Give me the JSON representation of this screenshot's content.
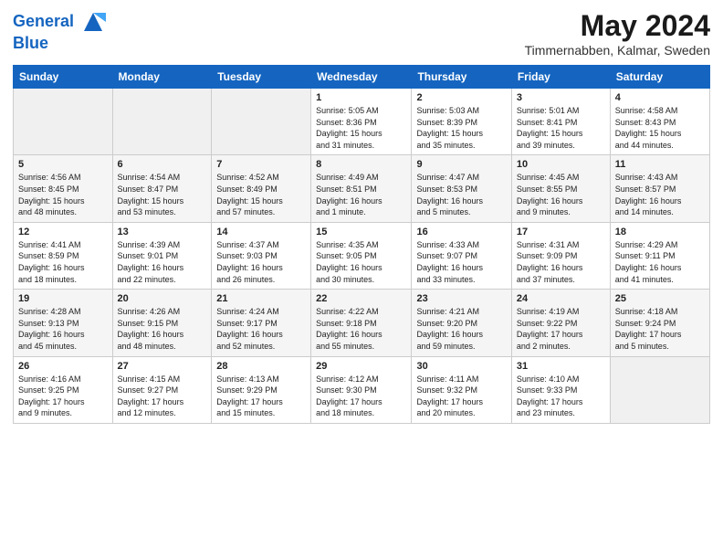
{
  "header": {
    "logo_line1": "General",
    "logo_line2": "Blue",
    "month_year": "May 2024",
    "location": "Timmernabben, Kalmar, Sweden"
  },
  "days_of_week": [
    "Sunday",
    "Monday",
    "Tuesday",
    "Wednesday",
    "Thursday",
    "Friday",
    "Saturday"
  ],
  "weeks": [
    [
      {
        "day": "",
        "info": ""
      },
      {
        "day": "",
        "info": ""
      },
      {
        "day": "",
        "info": ""
      },
      {
        "day": "1",
        "info": "Sunrise: 5:05 AM\nSunset: 8:36 PM\nDaylight: 15 hours\nand 31 minutes."
      },
      {
        "day": "2",
        "info": "Sunrise: 5:03 AM\nSunset: 8:39 PM\nDaylight: 15 hours\nand 35 minutes."
      },
      {
        "day": "3",
        "info": "Sunrise: 5:01 AM\nSunset: 8:41 PM\nDaylight: 15 hours\nand 39 minutes."
      },
      {
        "day": "4",
        "info": "Sunrise: 4:58 AM\nSunset: 8:43 PM\nDaylight: 15 hours\nand 44 minutes."
      }
    ],
    [
      {
        "day": "5",
        "info": "Sunrise: 4:56 AM\nSunset: 8:45 PM\nDaylight: 15 hours\nand 48 minutes."
      },
      {
        "day": "6",
        "info": "Sunrise: 4:54 AM\nSunset: 8:47 PM\nDaylight: 15 hours\nand 53 minutes."
      },
      {
        "day": "7",
        "info": "Sunrise: 4:52 AM\nSunset: 8:49 PM\nDaylight: 15 hours\nand 57 minutes."
      },
      {
        "day": "8",
        "info": "Sunrise: 4:49 AM\nSunset: 8:51 PM\nDaylight: 16 hours\nand 1 minute."
      },
      {
        "day": "9",
        "info": "Sunrise: 4:47 AM\nSunset: 8:53 PM\nDaylight: 16 hours\nand 5 minutes."
      },
      {
        "day": "10",
        "info": "Sunrise: 4:45 AM\nSunset: 8:55 PM\nDaylight: 16 hours\nand 9 minutes."
      },
      {
        "day": "11",
        "info": "Sunrise: 4:43 AM\nSunset: 8:57 PM\nDaylight: 16 hours\nand 14 minutes."
      }
    ],
    [
      {
        "day": "12",
        "info": "Sunrise: 4:41 AM\nSunset: 8:59 PM\nDaylight: 16 hours\nand 18 minutes."
      },
      {
        "day": "13",
        "info": "Sunrise: 4:39 AM\nSunset: 9:01 PM\nDaylight: 16 hours\nand 22 minutes."
      },
      {
        "day": "14",
        "info": "Sunrise: 4:37 AM\nSunset: 9:03 PM\nDaylight: 16 hours\nand 26 minutes."
      },
      {
        "day": "15",
        "info": "Sunrise: 4:35 AM\nSunset: 9:05 PM\nDaylight: 16 hours\nand 30 minutes."
      },
      {
        "day": "16",
        "info": "Sunrise: 4:33 AM\nSunset: 9:07 PM\nDaylight: 16 hours\nand 33 minutes."
      },
      {
        "day": "17",
        "info": "Sunrise: 4:31 AM\nSunset: 9:09 PM\nDaylight: 16 hours\nand 37 minutes."
      },
      {
        "day": "18",
        "info": "Sunrise: 4:29 AM\nSunset: 9:11 PM\nDaylight: 16 hours\nand 41 minutes."
      }
    ],
    [
      {
        "day": "19",
        "info": "Sunrise: 4:28 AM\nSunset: 9:13 PM\nDaylight: 16 hours\nand 45 minutes."
      },
      {
        "day": "20",
        "info": "Sunrise: 4:26 AM\nSunset: 9:15 PM\nDaylight: 16 hours\nand 48 minutes."
      },
      {
        "day": "21",
        "info": "Sunrise: 4:24 AM\nSunset: 9:17 PM\nDaylight: 16 hours\nand 52 minutes."
      },
      {
        "day": "22",
        "info": "Sunrise: 4:22 AM\nSunset: 9:18 PM\nDaylight: 16 hours\nand 55 minutes."
      },
      {
        "day": "23",
        "info": "Sunrise: 4:21 AM\nSunset: 9:20 PM\nDaylight: 16 hours\nand 59 minutes."
      },
      {
        "day": "24",
        "info": "Sunrise: 4:19 AM\nSunset: 9:22 PM\nDaylight: 17 hours\nand 2 minutes."
      },
      {
        "day": "25",
        "info": "Sunrise: 4:18 AM\nSunset: 9:24 PM\nDaylight: 17 hours\nand 5 minutes."
      }
    ],
    [
      {
        "day": "26",
        "info": "Sunrise: 4:16 AM\nSunset: 9:25 PM\nDaylight: 17 hours\nand 9 minutes."
      },
      {
        "day": "27",
        "info": "Sunrise: 4:15 AM\nSunset: 9:27 PM\nDaylight: 17 hours\nand 12 minutes."
      },
      {
        "day": "28",
        "info": "Sunrise: 4:13 AM\nSunset: 9:29 PM\nDaylight: 17 hours\nand 15 minutes."
      },
      {
        "day": "29",
        "info": "Sunrise: 4:12 AM\nSunset: 9:30 PM\nDaylight: 17 hours\nand 18 minutes."
      },
      {
        "day": "30",
        "info": "Sunrise: 4:11 AM\nSunset: 9:32 PM\nDaylight: 17 hours\nand 20 minutes."
      },
      {
        "day": "31",
        "info": "Sunrise: 4:10 AM\nSunset: 9:33 PM\nDaylight: 17 hours\nand 23 minutes."
      },
      {
        "day": "",
        "info": ""
      }
    ]
  ]
}
